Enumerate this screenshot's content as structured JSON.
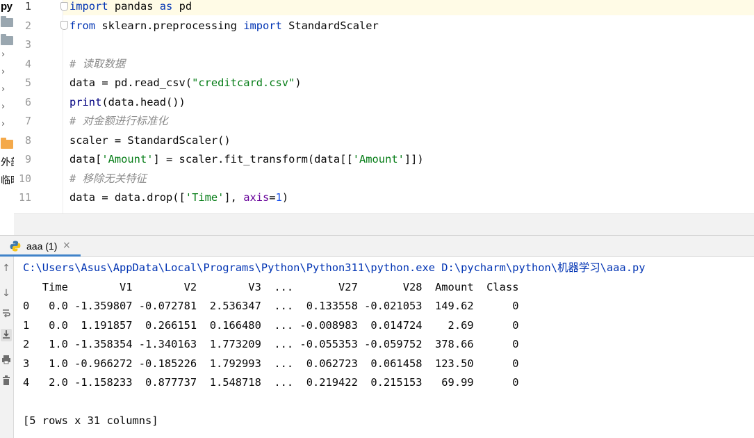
{
  "project_strip": {
    "label": "py",
    "items": [
      "外部",
      "临时"
    ]
  },
  "editor": {
    "line_numbers": [
      "1",
      "2",
      "3",
      "4",
      "5",
      "6",
      "7",
      "8",
      "9",
      "10",
      "11"
    ],
    "lines": [
      [
        {
          "t": "import",
          "c": "kw"
        },
        {
          "t": " pandas ",
          "c": ""
        },
        {
          "t": "as",
          "c": "kw"
        },
        {
          "t": " pd",
          "c": ""
        }
      ],
      [
        {
          "t": "from",
          "c": "kw"
        },
        {
          "t": " sklearn.preprocessing ",
          "c": ""
        },
        {
          "t": "import",
          "c": "kw"
        },
        {
          "t": " StandardScaler",
          "c": ""
        }
      ],
      [],
      [
        {
          "t": "# 读取数据",
          "c": "cmt"
        }
      ],
      [
        {
          "t": "data = pd.read_csv(",
          "c": ""
        },
        {
          "t": "\"creditcard.csv\"",
          "c": "str"
        },
        {
          "t": ")",
          "c": ""
        }
      ],
      [
        {
          "t": "print",
          "c": "builtin"
        },
        {
          "t": "(data.head())",
          "c": ""
        }
      ],
      [
        {
          "t": "# 对金额进行标准化",
          "c": "cmt"
        }
      ],
      [
        {
          "t": "scaler = StandardScaler()",
          "c": ""
        }
      ],
      [
        {
          "t": "data[",
          "c": ""
        },
        {
          "t": "'Amount'",
          "c": "str"
        },
        {
          "t": "] = scaler.fit_transform(data[[",
          "c": ""
        },
        {
          "t": "'Amount'",
          "c": "str"
        },
        {
          "t": "]])",
          "c": ""
        }
      ],
      [
        {
          "t": "# 移除无关特征",
          "c": "cmt"
        }
      ],
      [
        {
          "t": "data = data.drop([",
          "c": ""
        },
        {
          "t": "'Time'",
          "c": "str"
        },
        {
          "t": "], ",
          "c": ""
        },
        {
          "t": "axis",
          "c": "param"
        },
        {
          "t": "=",
          "c": ""
        },
        {
          "t": "1",
          "c": "num"
        },
        {
          "t": ")",
          "c": ""
        }
      ]
    ]
  },
  "run_panel": {
    "tab_label": "aaa (1)",
    "tab_close": "×",
    "toolbar_icons": [
      "arrow-up-icon",
      "arrow-down-icon",
      "soft-wrap-icon",
      "scroll-to-end-icon",
      "print-icon",
      "delete-icon"
    ],
    "console_lines": [
      "C:\\Users\\Asus\\AppData\\Local\\Programs\\Python\\Python311\\python.exe D:\\pycharm\\python\\机器学习\\aaa.py",
      "   Time        V1        V2        V3  ...       V27       V28  Amount  Class",
      "0   0.0 -1.359807 -0.072781  2.536347  ...  0.133558 -0.021053  149.62      0",
      "1   0.0  1.191857  0.266151  0.166480  ... -0.008983  0.014724    2.69      0",
      "2   1.0 -1.358354 -1.340163  1.773209  ... -0.055353 -0.059752  378.66      0",
      "3   1.0 -0.966272 -0.185226  1.792993  ...  0.062723  0.061458  123.50      0",
      "4   2.0 -1.158233  0.877737  1.548718  ...  0.219422  0.215153   69.99      0",
      "",
      "[5 rows x 31 columns]"
    ]
  }
}
